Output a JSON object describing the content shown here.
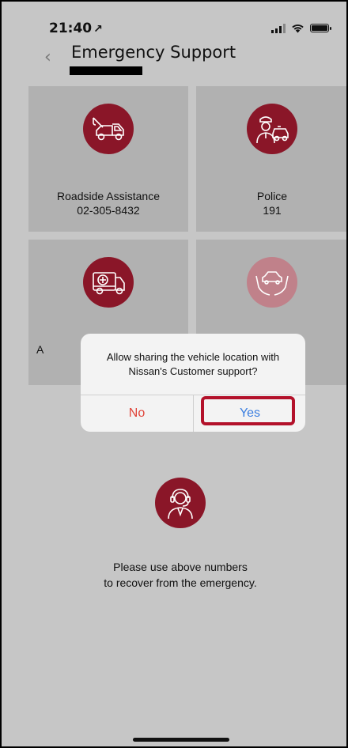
{
  "status_bar": {
    "time": "21:40",
    "location_arrow": "↗"
  },
  "header": {
    "back": "‹",
    "title": "Emergency Support"
  },
  "tiles": [
    {
      "label": "Roadside Assistance",
      "number": "02-305-8432",
      "icon": "tow-truck-icon"
    },
    {
      "label": "Police",
      "number": "191",
      "icon": "police-icon"
    },
    {
      "label": "A",
      "number": "",
      "icon": "ambulance-icon"
    },
    {
      "label": "",
      "number": "",
      "icon": "insurance-hands-car-icon"
    }
  ],
  "support": {
    "icon": "customer-support-headset-icon",
    "line1": "Please use above numbers",
    "line2": "to recover from the emergency."
  },
  "dialog": {
    "message_line1": "Allow sharing the vehicle location with",
    "message_line2": "Nissan's Customer support?",
    "no_label": "No",
    "yes_label": "Yes"
  },
  "colors": {
    "brand_red": "#8a1628",
    "tile_bg": "#b1b1b1",
    "screen_bg": "#c6c6c6",
    "no_button": "#e0453a",
    "yes_button": "#3a7ee0",
    "highlight": "#b3112a"
  }
}
